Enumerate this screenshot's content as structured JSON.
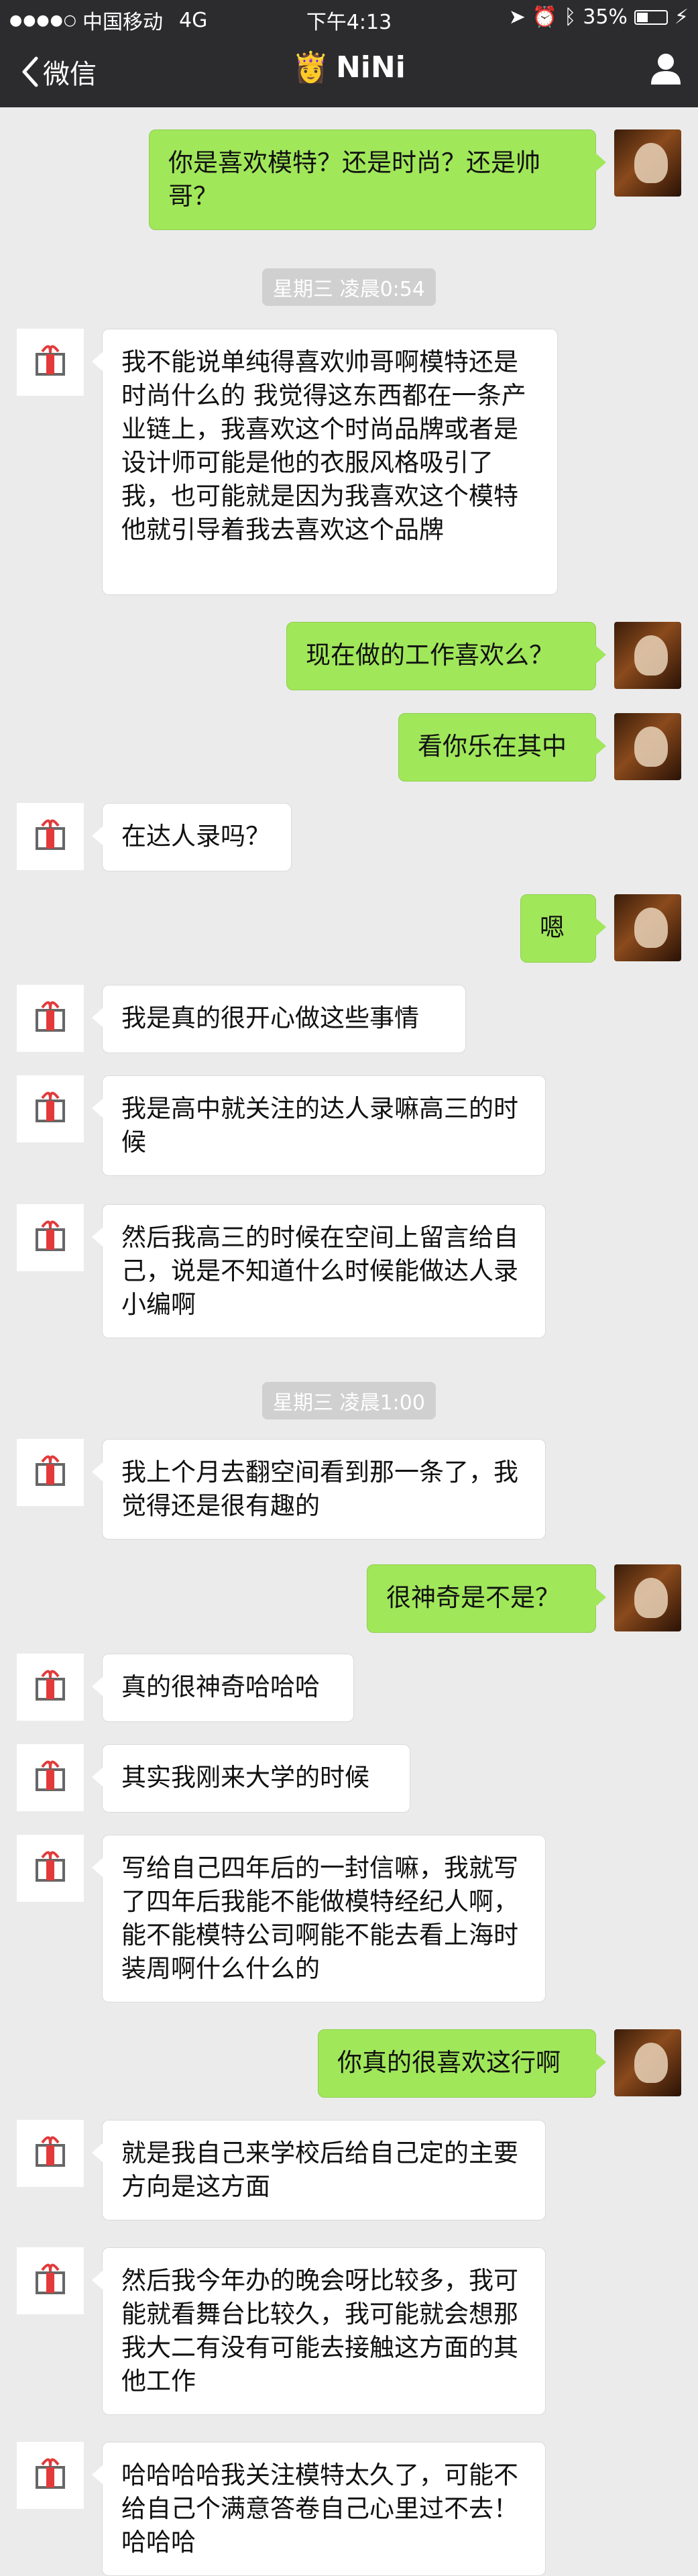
{
  "status_bar": {
    "carrier": "中国移动",
    "network": "4G",
    "time": "下午4:13",
    "battery": "35%"
  },
  "nav": {
    "back_label": "微信",
    "title_emoji": "👸",
    "title": "NiNi"
  },
  "timestamps": [
    "星期三 凌晨0:54",
    "星期三 凌晨1:00"
  ],
  "messages": [
    {
      "side": "right",
      "text": "你是喜欢模特？还是时尚？还是帅哥？"
    },
    {
      "side": "left",
      "text": "我不能说单纯得喜欢帅哥啊模特还是时尚什么的 我觉得这东西都在一条产业链上，我喜欢这个时尚品牌或者是设计师可能是他的衣服风格吸引了我，也可能就是因为我喜欢这个模特他就引导着我去喜欢这个品牌"
    },
    {
      "side": "right",
      "text": "现在做的工作喜欢么？"
    },
    {
      "side": "right",
      "text": "看你乐在其中"
    },
    {
      "side": "left",
      "text": "在达人录吗？"
    },
    {
      "side": "right",
      "text": "嗯"
    },
    {
      "side": "left",
      "text": "我是真的很开心做这些事情"
    },
    {
      "side": "left",
      "text": "我是高中就关注的达人录嘛高三的时候"
    },
    {
      "side": "left",
      "text": "然后我高三的时候在空间上留言给自己，说是不知道什么时候能做达人录小编啊"
    },
    {
      "side": "left",
      "text": "我上个月去翻空间看到那一条了，我觉得还是很有趣的"
    },
    {
      "side": "right",
      "text": "很神奇是不是？"
    },
    {
      "side": "left",
      "text": "真的很神奇哈哈哈"
    },
    {
      "side": "left",
      "text": "其实我刚来大学的时候"
    },
    {
      "side": "left",
      "text": "写给自己四年后的一封信嘛，我就写了四年后我能不能做模特经纪人啊，能不能模特公司啊能不能去看上海时装周啊什么什么的"
    },
    {
      "side": "right",
      "text": "你真的很喜欢这行啊"
    },
    {
      "side": "left",
      "text": "就是我自己来学校后给自己定的主要方向是这方面"
    },
    {
      "side": "left",
      "text": "然后我今年办的晚会呀比较多，我可能就看舞台比较久，我可能就会想那我大二有没有可能去接触这方面的其他工作"
    },
    {
      "side": "left",
      "text": "哈哈哈哈我关注模特太久了，可能不给自己个满意答卷自己心里过不去！哈哈哈"
    }
  ]
}
